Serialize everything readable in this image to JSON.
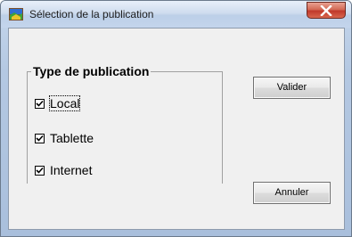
{
  "window": {
    "title": "Sélection de la publication",
    "icon": "app-icon",
    "close_glyph": "X"
  },
  "group": {
    "legend": "Type de publication",
    "options": [
      {
        "label": "Local",
        "checked": true,
        "focused": true
      },
      {
        "label": "Tablette",
        "checked": true,
        "focused": false
      },
      {
        "label": "Internet",
        "checked": true,
        "focused": false
      }
    ]
  },
  "buttons": {
    "validate_label": "Valider",
    "cancel_label": "Annuler"
  },
  "colors": {
    "dialog_bg": "#f0f0f0",
    "close_button": "#c0392b",
    "titlebar": "#cfdcee"
  }
}
